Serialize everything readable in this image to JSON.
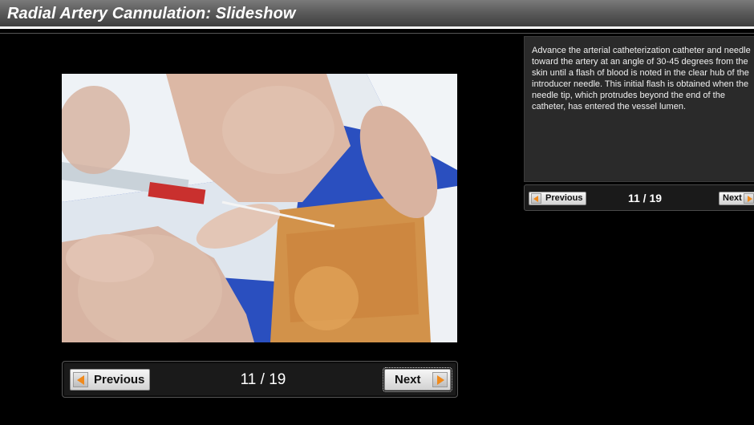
{
  "header": {
    "title": "Radial Artery Cannulation: Slideshow"
  },
  "slide": {
    "image_alt": "Hands advancing an arterial catheter with needle into the radial artery; flash of blood in the hub",
    "caption": "Advance the arterial catheterization catheter and needle toward the artery at an angle of 30-45 degrees from the skin until a flash of blood is noted in the clear hub of the introducer needle. This initial flash is obtained when the needle tip, which protrudes beyond the end of the catheter, has entered the vessel lumen."
  },
  "main_nav": {
    "previous_label": "Previous",
    "next_label": "Next",
    "counter": "11 / 19"
  },
  "side_nav": {
    "previous_label": "Previous",
    "next_label": "Next",
    "counter": "11 / 19"
  },
  "icons": {
    "previous": "arrow-left-icon",
    "next": "arrow-right-icon"
  },
  "colors": {
    "accent_arrow": "#f08a1c",
    "background": "#000000",
    "panel": "#2a2a2a"
  }
}
